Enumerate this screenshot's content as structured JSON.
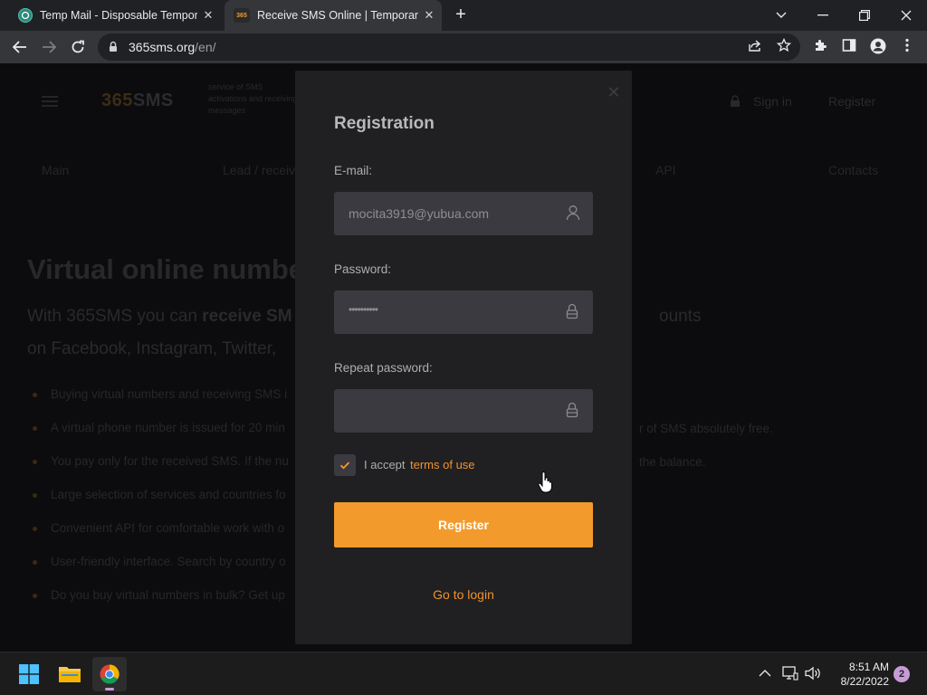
{
  "browser": {
    "tabs": [
      {
        "title": "Temp Mail - Disposable Temporary",
        "active": false,
        "favicon": "tempmail-icon"
      },
      {
        "title": "Receive SMS Online | Temporary",
        "active": true,
        "favicon": "365sms-favicon",
        "favicon_text": "365"
      }
    ],
    "url_host": "365sms.org",
    "url_path": "/en/"
  },
  "site": {
    "logo_a": "365",
    "logo_b": "SMS",
    "tagline": "service of SMS activations and receiving messages",
    "sign_in": "Sign in",
    "register": "Register",
    "nav": [
      "Main",
      "Lead / receive",
      "API",
      "Contacts"
    ],
    "hero_title": "Virtual online numbe",
    "hero_sub_l1_a": "With 365SMS you can ",
    "hero_sub_l1_b": "receive SM",
    "hero_sub_l1_c": "ounts",
    "hero_sub_l2": "on Facebook, Instagram, Twitter,",
    "bullets": [
      "Buying virtual numbers and receiving SMS i",
      "A virtual phone number is issued for 20 min",
      "You pay only for the received SMS. If the nu",
      "Large selection of services and countries fo",
      "Convenient API for comfortable work with o",
      "User-friendly interface. Search by country o",
      "Do you buy virtual numbers in bulk? Get up"
    ],
    "bullets_right": [
      {
        "row": 1,
        "text": "r of SMS absolutely free."
      },
      {
        "row": 2,
        "text": "the balance."
      }
    ]
  },
  "modal": {
    "title": "Registration",
    "email_label": "E-mail:",
    "email_value": "mocita3919@yubua.com",
    "password_label": "Password:",
    "password_value": "••••••••••",
    "repeat_label": "Repeat password:",
    "repeat_value": "",
    "accept_prefix": "I accept",
    "terms_link": "terms of use",
    "terms_checked": true,
    "register_button": "Register",
    "login_link": "Go to login",
    "accent_color": "#f39a2c"
  },
  "taskbar": {
    "time": "8:51 AM",
    "date": "8/22/2022",
    "notification_count": "2"
  }
}
